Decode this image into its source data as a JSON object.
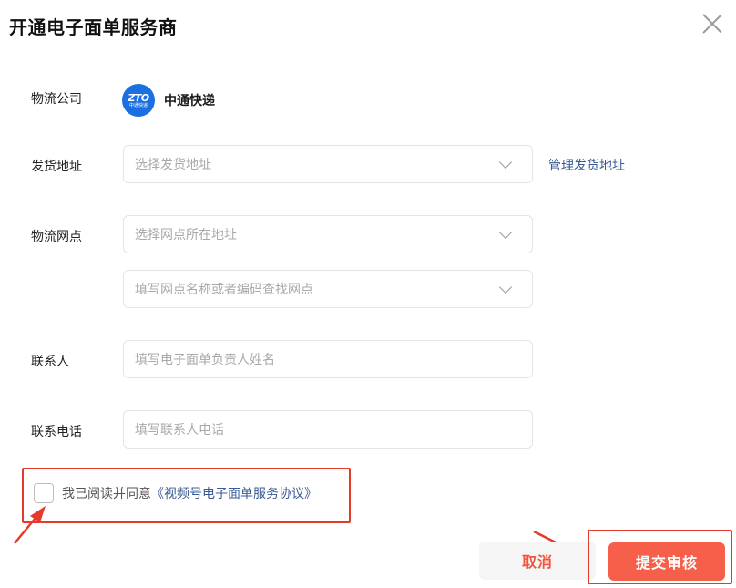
{
  "dialog": {
    "title": "开通电子面单服务商",
    "close_icon": "close-icon"
  },
  "logistics_company": {
    "label": "物流公司",
    "logo_text": "ZTO",
    "logo_subtext": "中通快递",
    "name": "中通快递"
  },
  "ship_address": {
    "label": "发货地址",
    "placeholder": "选择发货地址",
    "manage_link": "管理发货地址"
  },
  "logistics_outlet": {
    "label": "物流网点",
    "region_placeholder": "选择网点所在地址",
    "search_placeholder": "填写网点名称或者编码查找网点"
  },
  "contact": {
    "label": "联系人",
    "placeholder": "填写电子面单负责人姓名"
  },
  "phone": {
    "label": "联系电话",
    "placeholder": "填写联系人电话"
  },
  "agreement": {
    "checked": false,
    "prefix": "我已阅读并同意",
    "link": "《视频号电子面单服务协议》"
  },
  "footer": {
    "cancel_label": "取消",
    "submit_label": "提交审核"
  },
  "colors": {
    "accent": "#f6604a",
    "link": "#3a5a94",
    "annotation": "#e53a2a",
    "zto_blue": "#1b6fe0"
  }
}
